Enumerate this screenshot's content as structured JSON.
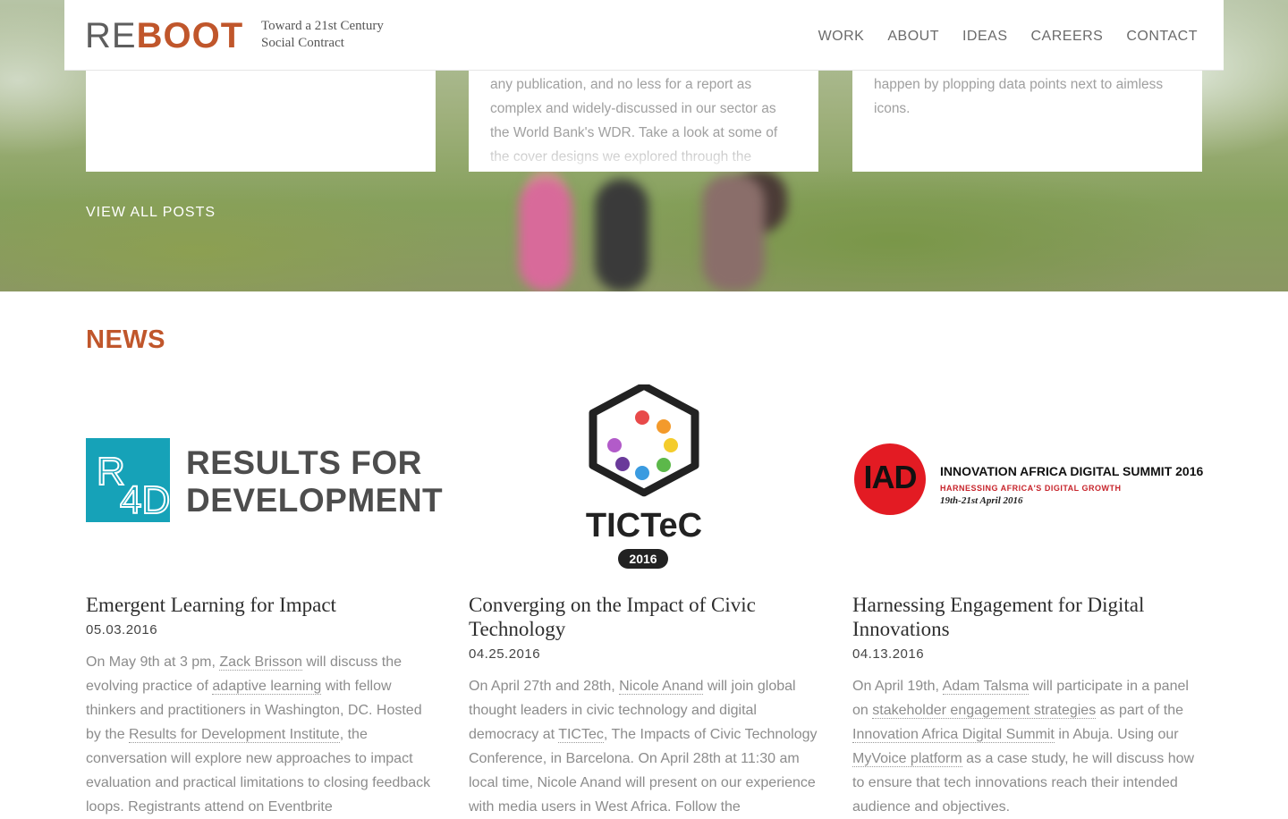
{
  "header": {
    "logo_re": "RE",
    "logo_boot": "BOOT",
    "tagline_line1": "Toward a 21st Century",
    "tagline_line2": "Social Contract",
    "nav": [
      "WORK",
      "ABOUT",
      "IDEAS",
      "CAREERS",
      "CONTACT"
    ]
  },
  "posts": {
    "card2_text": "any publication, and no less for a report as complex and widely-discussed in our sector as the World Bank's WDR. Take a look at some of the cover designs we explored through the",
    "card3_text": "happen by plopping data points next to aimless icons.",
    "view_all": "VIEW ALL POSTS"
  },
  "news": {
    "heading": "NEWS",
    "items": [
      {
        "logo": {
          "line1": "RESULTS FOR",
          "line2": "DEVELOPMENT"
        },
        "title": "Emergent Learning for Impact",
        "date": "05.03.2016",
        "body": [
          {
            "t": "On May 9th at 3 pm, "
          },
          {
            "t": "Zack Brisson",
            "link": true
          },
          {
            "t": " will discuss the evolving practice of "
          },
          {
            "t": "adaptive learning",
            "link": true
          },
          {
            "t": " with fellow thinkers and practitioners in Washington, DC. Hosted by the "
          },
          {
            "t": "Results for Development Institute",
            "link": true
          },
          {
            "t": ", the conversation will explore new approaches to impact evaluation and practical limitations to closing feedback loops. Registrants attend on Eventbrite"
          }
        ]
      },
      {
        "logo": {
          "word": "TICTeC",
          "year": "2016"
        },
        "title": "Converging on the Impact of Civic Technology",
        "date": "04.25.2016",
        "body": [
          {
            "t": "On April 27th and 28th, "
          },
          {
            "t": "Nicole Anand",
            "link": true
          },
          {
            "t": " will join global thought leaders in civic technology and digital democracy at "
          },
          {
            "t": "TICTec",
            "link": true
          },
          {
            "t": ", The Impacts of Civic Technology Conference, in Barcelona. On April 28th at 11:30 am local time, Nicole Anand will present on our experience with media users in West Africa. Follow the"
          }
        ]
      },
      {
        "logo": {
          "letters": "IAD",
          "title": "INNOVATION AFRICA DIGITAL SUMMIT 2016",
          "sub": "HARNESSING AFRICA'S DIGITAL GROWTH",
          "dates": "19th-21st April 2016"
        },
        "title": "Harnessing Engagement for Digital Innovations",
        "date": "04.13.2016",
        "body": [
          {
            "t": "On April 19th, "
          },
          {
            "t": "Adam Talsma",
            "link": true
          },
          {
            "t": " will participate in a panel on "
          },
          {
            "t": "stakeholder engagement strategies",
            "link": true
          },
          {
            "t": " as part of the "
          },
          {
            "t": "Innovation Africa Digital Summit",
            "link": true
          },
          {
            "t": " in Abuja. Using our "
          },
          {
            "t": "MyVoice platform",
            "link": true
          },
          {
            "t": " as a case study, he will discuss how to ensure that tech innovations reach their intended audience and objectives."
          }
        ]
      }
    ]
  },
  "colors": {
    "brand_orange": "#c0562b",
    "r4d_teal": "#16a2b8",
    "iad_red": "#e31b23"
  }
}
